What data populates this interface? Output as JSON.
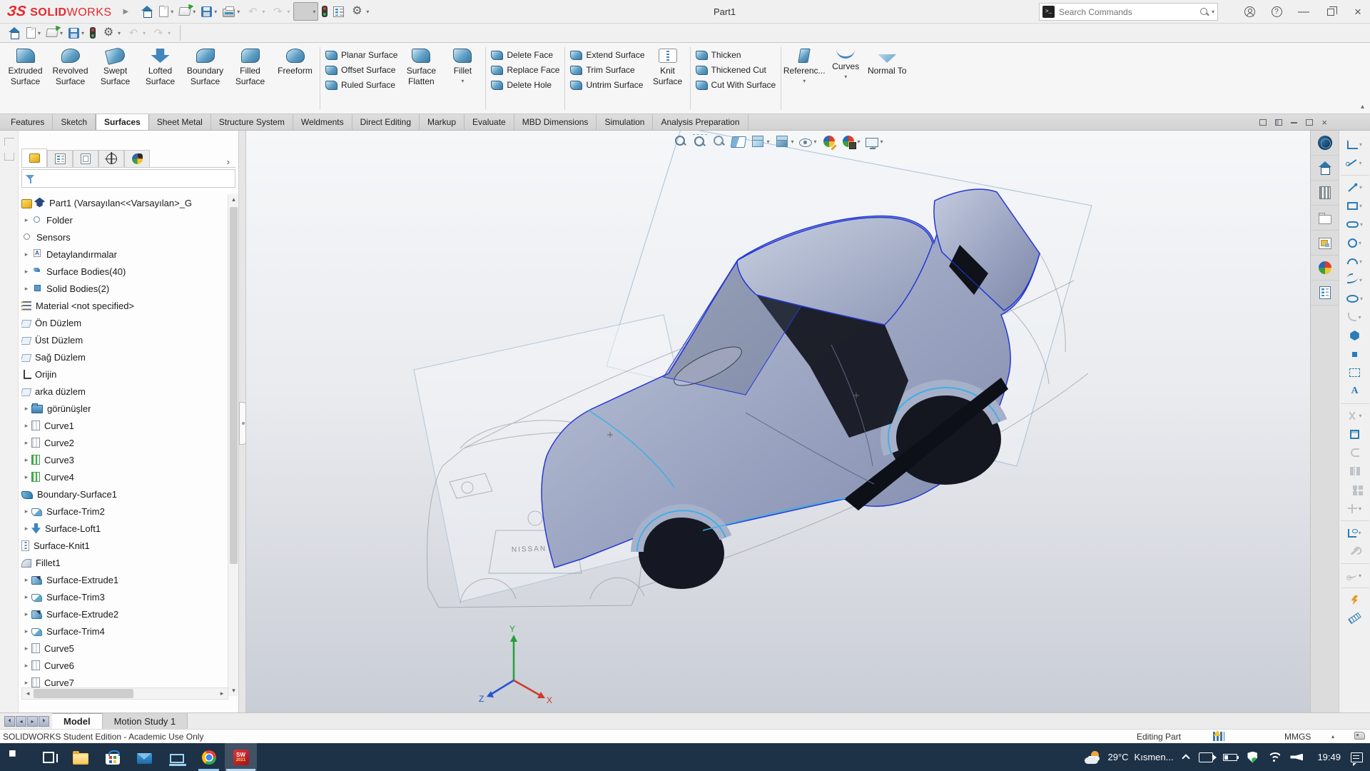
{
  "titlebar": {
    "brand_mark": "ЗS",
    "brand_bold": "SOLID",
    "brand_light": "WORKS",
    "title": "Part1",
    "search": {
      "placeholder": "Search Commands"
    }
  },
  "qa_row1": [
    {
      "icon": "home-icon"
    },
    {
      "icon": "new-doc-icon",
      "dd": true
    },
    {
      "icon": "open-icon",
      "dd": true
    },
    {
      "icon": "save-icon",
      "dd": true
    },
    {
      "icon": "print-icon",
      "dd": true
    },
    {
      "icon": "undo-icon",
      "glyph": "↶",
      "dd": true,
      "disabled": true
    },
    {
      "icon": "redo-icon",
      "glyph": "↷",
      "dd": true,
      "disabled": true
    },
    {
      "icon": "select-cursor-icon",
      "dd": true,
      "active": true
    },
    {
      "icon": "rebuild-icon"
    },
    {
      "icon": "file-properties-icon"
    },
    {
      "icon": "options-gear-icon",
      "glyph": "⚙",
      "dd": true
    }
  ],
  "qa_row2": [
    {
      "icon": "home-icon"
    },
    {
      "icon": "new-doc-icon",
      "dd": true
    },
    {
      "icon": "open-icon",
      "dd": true
    },
    {
      "icon": "save-icon",
      "dd": true
    },
    {
      "icon": "rebuild-icon"
    },
    {
      "icon": "options-gear-icon",
      "glyph": "⚙",
      "dd": true
    },
    {
      "icon": "undo-icon",
      "glyph": "↶",
      "dd": true,
      "disabled": true
    },
    {
      "icon": "redo-icon",
      "glyph": "↷",
      "dd": true,
      "disabled": true
    }
  ],
  "ribbon": {
    "g1": [
      {
        "label": "Extruded Surface",
        "icon": "extruded-surface-icon"
      },
      {
        "label": "Revolved Surface",
        "icon": "revolved-surface-icon"
      },
      {
        "label": "Swept Surface",
        "icon": "swept-surface-icon"
      },
      {
        "label": "Lofted Surface",
        "icon": "lofted-surface-icon"
      },
      {
        "label": "Boundary Surface",
        "icon": "boundary-surface-ri-icon"
      },
      {
        "label": "Filled Surface",
        "icon": "filled-surface-icon"
      },
      {
        "label": "Freeform",
        "icon": "freeform-icon"
      }
    ],
    "g2_small": [
      {
        "label": "Planar Surface",
        "icon": "planar-surface-icon"
      },
      {
        "label": "Offset Surface",
        "icon": "offset-surface-icon"
      },
      {
        "label": "Ruled Surface",
        "icon": "ruled-surface-icon"
      }
    ],
    "g2_large": [
      {
        "label": "Surface Flatten",
        "icon": "surface-flatten-icon"
      },
      {
        "label": "Fillet",
        "icon": "fillet-ri-icon",
        "dd": true
      }
    ],
    "g3_small": [
      {
        "label": "Delete Face",
        "icon": "delete-face-icon"
      },
      {
        "label": "Replace Face",
        "icon": "replace-face-icon"
      },
      {
        "label": "Delete Hole",
        "icon": "delete-hole-icon"
      }
    ],
    "g4_small": [
      {
        "label": "Extend Surface",
        "icon": "extend-surface-icon"
      },
      {
        "label": "Trim Surface",
        "icon": "trim-surface-icon"
      },
      {
        "label": "Untrim Surface",
        "icon": "untrim-surface-icon"
      }
    ],
    "g4_large": [
      {
        "label": "Knit Surface",
        "icon": "knit-ri-icon"
      }
    ],
    "g5_small": [
      {
        "label": "Thicken",
        "icon": "thicken-icon"
      },
      {
        "label": "Thickened Cut",
        "icon": "thickened-cut-icon"
      },
      {
        "label": "Cut With Surface",
        "icon": "cut-with-surface-icon"
      }
    ],
    "g6_large": [
      {
        "label": "Referenc...",
        "icon": "reference-geometry-icon",
        "dd": true
      },
      {
        "label": "Curves",
        "icon": "curves-icon",
        "dd": true
      },
      {
        "label": "Normal To",
        "icon": "normal-to-icon"
      }
    ]
  },
  "cm_tabs": [
    {
      "label": "Features"
    },
    {
      "label": "Sketch"
    },
    {
      "label": "Surfaces",
      "active": true
    },
    {
      "label": "Sheet Metal"
    },
    {
      "label": "Structure System"
    },
    {
      "label": "Weldments"
    },
    {
      "label": "Direct Editing"
    },
    {
      "label": "Markup"
    },
    {
      "label": "Evaluate"
    },
    {
      "label": "MBD Dimensions"
    },
    {
      "label": "Simulation"
    },
    {
      "label": "Analysis Preparation"
    }
  ],
  "tree": [
    {
      "label": "Part1 (Varsayılan<<Varsayılan>_G",
      "icon": "part-icon",
      "icon2": "cap-icon"
    },
    {
      "label": "Folder",
      "icon": "folder-history-icon",
      "folder": true,
      "arrow": true
    },
    {
      "label": "Sensors",
      "icon": "sensors-icon",
      "folder": true
    },
    {
      "label": "Detaylandırmalar",
      "icon": "annotations-icon",
      "folder": true,
      "arrow": true
    },
    {
      "label": "Surface Bodies(40)",
      "icon": "surface-bodies-icon",
      "folder": true,
      "arrow": true
    },
    {
      "label": "Solid Bodies(2)",
      "icon": "solid-bodies-icon",
      "folder": true,
      "arrow": true
    },
    {
      "label": "Material <not specified>",
      "icon": "material-icon"
    },
    {
      "label": "Ön Düzlem",
      "icon": "plane-icon"
    },
    {
      "label": "Üst Düzlem",
      "icon": "plane-icon"
    },
    {
      "label": "Sağ Düzlem",
      "icon": "plane-icon"
    },
    {
      "label": "Orijin",
      "icon": "origin-icon"
    },
    {
      "label": "arka düzlem",
      "icon": "plane-icon"
    },
    {
      "label": "görünüşler",
      "icon": "folder-blue-icon",
      "arrow": true
    },
    {
      "label": "Curve1",
      "icon": "curve-icon",
      "arrow": true
    },
    {
      "label": "Curve2",
      "icon": "curve-icon",
      "arrow": true
    },
    {
      "label": "Curve3",
      "icon": "curve-green-icon",
      "arrow": true
    },
    {
      "label": "Curve4",
      "icon": "curve-green-icon",
      "arrow": true
    },
    {
      "label": "Boundary-Surface1",
      "icon": "boundary-surface-icon"
    },
    {
      "label": "Surface-Trim2",
      "icon": "trim-icon",
      "arrow": true
    },
    {
      "label": "Surface-Loft1",
      "icon": "loft-icon",
      "arrow": true
    },
    {
      "label": "Surface-Knit1",
      "icon": "knit-icon"
    },
    {
      "label": "Fillet1",
      "icon": "fillet-icon"
    },
    {
      "label": "Surface-Extrude1",
      "icon": "extrude-icon",
      "arrow": true
    },
    {
      "label": "Surface-Trim3",
      "icon": "trim-icon",
      "arrow": true
    },
    {
      "label": "Surface-Extrude2",
      "icon": "extrude-icon",
      "arrow": true
    },
    {
      "label": "Surface-Trim4",
      "icon": "trim-icon",
      "arrow": true
    },
    {
      "label": "Curve5",
      "icon": "curve-icon",
      "arrow": true
    },
    {
      "label": "Curve6",
      "icon": "curve-icon",
      "arrow": true
    },
    {
      "label": "Curve7",
      "icon": "curve-icon",
      "arrow": true
    },
    {
      "label": "",
      "icon": "trim-icon",
      "arrow": true
    }
  ],
  "hud": [
    {
      "icon": "zoom-fit-icon"
    },
    {
      "icon": "zoom-area-icon"
    },
    {
      "icon": "previous-view-icon"
    },
    {
      "icon": "section-view-icon"
    },
    {
      "icon": "view-orientation-icon",
      "dd": true
    },
    {
      "icon": "display-style-icon",
      "dd": true
    },
    {
      "icon": "hide-show-icon",
      "dd": true
    },
    {
      "icon": "edit-appearance-icon"
    },
    {
      "icon": "apply-scene-icon",
      "dd": true
    },
    {
      "icon": "view-settings-icon",
      "dd": true
    }
  ],
  "taskpane": [
    {
      "icon": "solidworks-resources-icon"
    },
    {
      "icon": "tp-home-icon"
    },
    {
      "icon": "design-library-icon"
    },
    {
      "icon": "file-explorer-icon"
    },
    {
      "icon": "view-palette-icon"
    },
    {
      "icon": "appearances-scenes-icon"
    },
    {
      "icon": "custom-properties-icon"
    }
  ],
  "sketchbar": [
    {
      "icon": "sketch-icon",
      "dd": true
    },
    {
      "icon": "smart-dimension-icon",
      "dd": true
    },
    {
      "icon": "line-icon",
      "dd": true,
      "sep": true
    },
    {
      "icon": "rectangle-icon",
      "dd": true
    },
    {
      "icon": "slot-icon",
      "dd": true
    },
    {
      "icon": "circle-icon",
      "dd": true
    },
    {
      "icon": "arc-icon",
      "dd": true
    },
    {
      "icon": "spline-icon",
      "dd": true
    },
    {
      "icon": "ellipse-icon",
      "dd": true
    },
    {
      "icon": "sketch-fillet-icon",
      "dd": true,
      "gray": true
    },
    {
      "icon": "polygon-icon"
    },
    {
      "icon": "point-icon"
    },
    {
      "icon": "textbox-icon"
    },
    {
      "icon": "text-a-icon",
      "glyph": "A"
    },
    {
      "icon": "trim-sk-icon",
      "dd": true,
      "gray": true,
      "sep": true
    },
    {
      "icon": "convert-icon"
    },
    {
      "icon": "offset-icon",
      "gray": true
    },
    {
      "icon": "mirror-icon",
      "gray": true
    },
    {
      "icon": "pattern-icon",
      "dd": true,
      "gray": true
    },
    {
      "icon": "move-icon",
      "dd": true,
      "gray": true
    },
    {
      "icon": "relations-icon",
      "dd": true,
      "sep": true
    },
    {
      "icon": "repair-icon",
      "gray": true
    },
    {
      "icon": "path-icon",
      "dd": true,
      "gray": true,
      "sep": true
    },
    {
      "icon": "snaps-icon",
      "sep": true
    },
    {
      "icon": "ruler-icon"
    }
  ],
  "model_tabs": [
    {
      "label": "Model",
      "active": true
    },
    {
      "label": "Motion Study 1"
    }
  ],
  "statusbar": {
    "left": "SOLIDWORKS Student Edition - Academic Use Only",
    "editing": "Editing Part",
    "units": "MMGS"
  },
  "taskbar": {
    "left": [
      {
        "icon": "start-icon"
      },
      {
        "icon": "task-view-icon"
      },
      {
        "icon": "folder-tb-icon"
      },
      {
        "icon": "store-icon"
      },
      {
        "icon": "mail-icon"
      },
      {
        "icon": "pc-icon"
      },
      {
        "icon": "chrome-icon",
        "running": true
      },
      {
        "icon": "solidworks-tb-icon",
        "sw": true,
        "active": true
      }
    ],
    "sw_label": "SW",
    "sw_year": "2021",
    "weather_temp": "29°C",
    "weather_desc": "Kısmen...",
    "clock": "19:49"
  },
  "viewport": {
    "sketch_text": "NISSAN",
    "triad": {
      "x": "X",
      "y": "Y",
      "z": "Z"
    }
  }
}
